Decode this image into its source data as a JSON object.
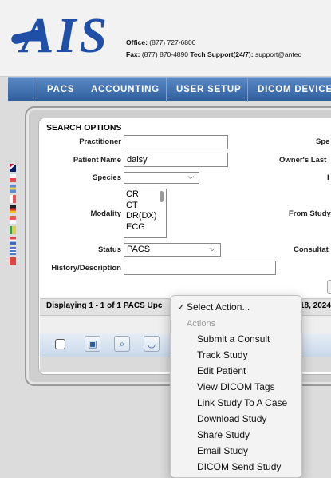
{
  "header": {
    "logo": "AIS",
    "office_label": "Office:",
    "office_phone": "(877) 727-6800",
    "fax_label": "Fax:",
    "fax_phone": "(877) 870-4890",
    "tech_label": "Tech Support(24/7):",
    "tech_email": "support@antec"
  },
  "nav": {
    "items": [
      "PACS",
      "ACCOUNTING",
      "USER SETUP",
      "DICOM DEVICES"
    ]
  },
  "search": {
    "title": "SEARCH OPTIONS",
    "practitioner_label": "Practitioner",
    "practitioner_value": "",
    "patient_name_label": "Patient Name",
    "patient_name_value": "daisy",
    "species_label": "Species",
    "species_value": "",
    "modality_label": "Modality",
    "modality_options": [
      "CR",
      "CT",
      "DR(DX)",
      "ECG"
    ],
    "status_label": "Status",
    "status_value": "PACS",
    "history_label": "History/Description",
    "history_value": "",
    "right_labels": {
      "species_trunc": "Spe",
      "owner_last": "Owner's Last",
      "right3": "I",
      "from_study": "From Study",
      "consultation": "Consultat"
    }
  },
  "results": {
    "display_text": "Displaying 1 - 1 of 1 PACS Upc",
    "display_date": "18, 2024"
  },
  "dropdown": {
    "selected": "Select Action...",
    "group_header": "Actions",
    "items": [
      "Submit a Consult",
      "Track Study",
      "Edit Patient",
      "View DICOM Tags",
      "Link Study To A Case",
      "Download Study",
      "Share Study",
      "Email Study",
      "DICOM Send Study"
    ]
  },
  "colors": {
    "brand_blue": "#1f4fa6",
    "nav_blue": "#3f6fb0"
  }
}
